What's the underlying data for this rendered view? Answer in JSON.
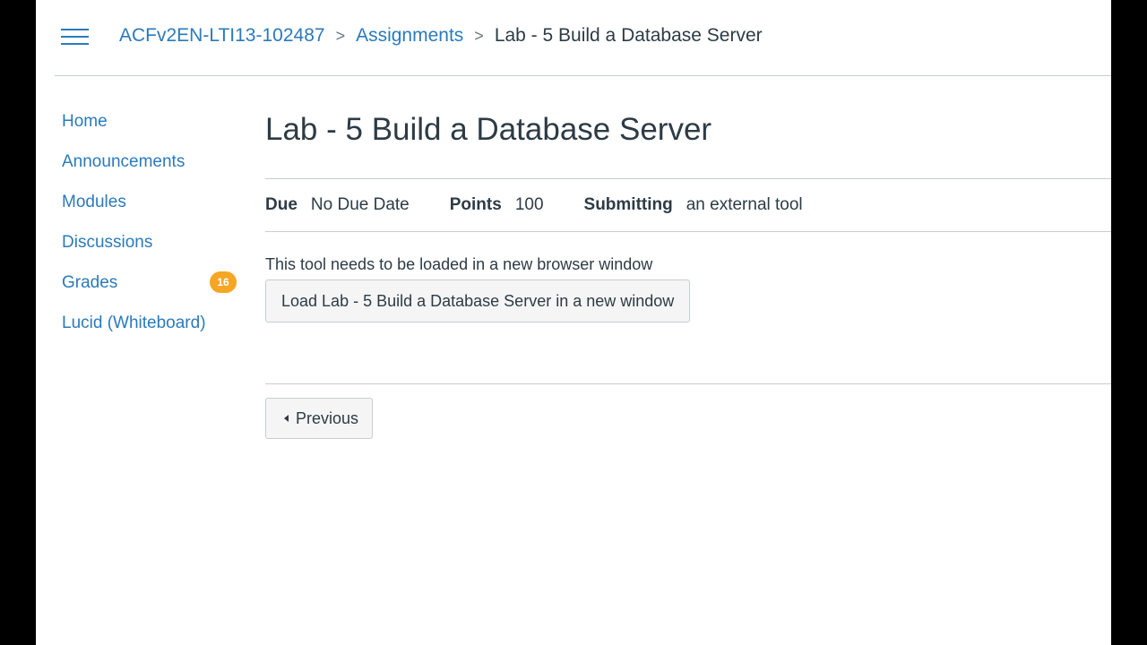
{
  "breadcrumb": {
    "course": "ACFv2EN-LTI13-102487",
    "section": "Assignments",
    "current": "Lab - 5 Build a Database Server",
    "separator": ">"
  },
  "nav": {
    "items": [
      {
        "label": "Home"
      },
      {
        "label": "Announcements"
      },
      {
        "label": "Modules"
      },
      {
        "label": "Discussions"
      },
      {
        "label": "Grades",
        "badge": "16"
      },
      {
        "label": "Lucid (Whiteboard)"
      }
    ]
  },
  "assignment": {
    "title": "Lab - 5 Build a Database Server",
    "due_label": "Due",
    "due_value": "No Due Date",
    "points_label": "Points",
    "points_value": "100",
    "submitting_label": "Submitting",
    "submitting_value": "an external tool",
    "tool_message": "This tool needs to be loaded in a new browser window",
    "load_button": "Load Lab - 5 Build a Database Server in a new window"
  },
  "footer": {
    "previous_label": "Previous"
  },
  "colors": {
    "link": "#2b7abc",
    "text": "#2d3b45",
    "badge": "#f5a623"
  }
}
